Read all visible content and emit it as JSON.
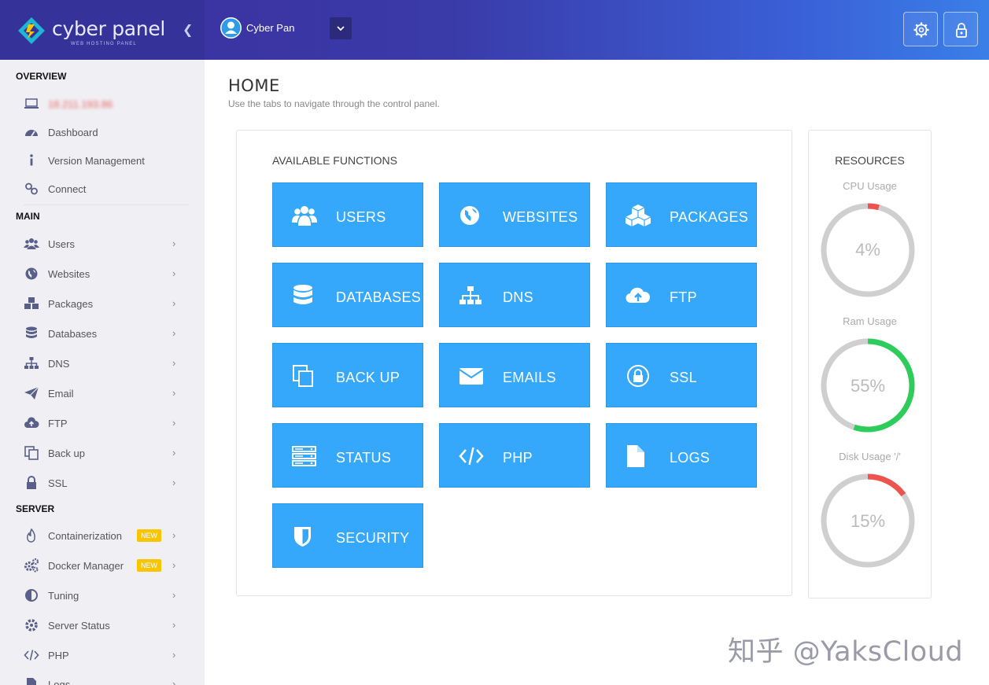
{
  "brand": {
    "name": "cyber panel",
    "subtitle": "WEB HOSTING PANEL"
  },
  "header": {
    "user_name": "Cyber Pan",
    "icons": [
      "gear-icon",
      "lock-icon"
    ]
  },
  "sidebar": {
    "sections": [
      {
        "title": "OVERVIEW",
        "items": [
          {
            "label": "18.211.193.86",
            "icon": "laptop-icon"
          },
          {
            "label": "Dashboard",
            "icon": "dashboard-icon"
          },
          {
            "label": "Version Management",
            "icon": "info-icon"
          },
          {
            "label": "Connect",
            "icon": "link-icon"
          }
        ]
      },
      {
        "title": "MAIN",
        "items": [
          {
            "label": "Users",
            "icon": "users-icon"
          },
          {
            "label": "Websites",
            "icon": "globe-icon"
          },
          {
            "label": "Packages",
            "icon": "cubes-icon"
          },
          {
            "label": "Databases",
            "icon": "database-icon"
          },
          {
            "label": "DNS",
            "icon": "sitemap-icon"
          },
          {
            "label": "Email",
            "icon": "paper-plane-icon"
          },
          {
            "label": "FTP",
            "icon": "cloud-upload-icon"
          },
          {
            "label": "Back up",
            "icon": "copy-icon"
          },
          {
            "label": "SSL",
            "icon": "lock-icon"
          }
        ]
      },
      {
        "title": "SERVER",
        "items": [
          {
            "label": "Containerization",
            "badge": "NEW",
            "icon": "fire-icon"
          },
          {
            "label": "Docker Manager",
            "badge": "NEW",
            "icon": "cogs-icon"
          },
          {
            "label": "Tuning",
            "icon": "adjust-icon"
          },
          {
            "label": "Server Status",
            "icon": "gear-icon"
          },
          {
            "label": "PHP",
            "icon": "code-icon"
          },
          {
            "label": "Logs",
            "icon": "file-icon"
          }
        ]
      }
    ]
  },
  "main": {
    "title": "HOME",
    "subtitle": "Use the tabs to navigate through the control panel.",
    "functions_title": "AVAILABLE FUNCTIONS",
    "tiles": [
      {
        "label": "USERS",
        "icon": "users-icon"
      },
      {
        "label": "WEBSITES",
        "icon": "globe-icon"
      },
      {
        "label": "PACKAGES",
        "icon": "cubes-icon"
      },
      {
        "label": "DATABASES",
        "icon": "database-icon"
      },
      {
        "label": "DNS",
        "icon": "sitemap-icon"
      },
      {
        "label": "FTP",
        "icon": "cloud-upload-icon"
      },
      {
        "label": "BACK UP",
        "icon": "copy-icon"
      },
      {
        "label": "EMAILS",
        "icon": "envelope-icon"
      },
      {
        "label": "SSL",
        "icon": "lock-icon"
      },
      {
        "label": "STATUS",
        "icon": "server-icon"
      },
      {
        "label": "PHP",
        "icon": "code-icon"
      },
      {
        "label": "LOGS",
        "icon": "file-icon"
      },
      {
        "label": "SECURITY",
        "icon": "shield-icon"
      }
    ]
  },
  "resources": {
    "title": "RESOURCES",
    "gauges": [
      {
        "label": "CPU Usage",
        "value_text": "4%",
        "percent": 4,
        "color": "#ef5350"
      },
      {
        "label": "Ram Usage",
        "value_text": "55%",
        "percent": 55,
        "color": "#2ecc5a"
      },
      {
        "label": "Disk Usage '/'",
        "value_text": "15%",
        "percent": 15,
        "color": "#ef5350"
      }
    ]
  },
  "watermark": "知乎 @YaksCloud",
  "colors": {
    "tile": "#35a8fb",
    "header_start": "#3c2f9e",
    "header_end": "#3a7fe8",
    "sidebar_bg": "#f0f0f4",
    "badge": "#f7c600"
  }
}
